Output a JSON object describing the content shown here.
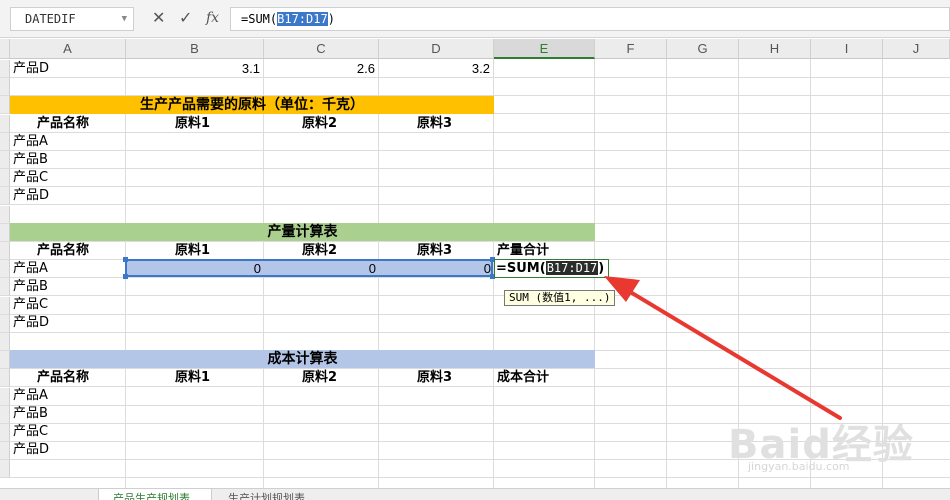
{
  "formula_bar": {
    "name_box": "DATEDIF",
    "cancel_icon": "close-icon",
    "confirm_icon": "check-icon",
    "fx_label": "fx",
    "formula_prefix": "=SUM(",
    "formula_ref": "B17:D17",
    "formula_suffix": ")"
  },
  "columns": [
    "A",
    "B",
    "C",
    "D",
    "E",
    "F",
    "G",
    "H",
    "I",
    "J"
  ],
  "active_column": "E",
  "product_d_row": {
    "label": "产品D",
    "b": "3.1",
    "c": "2.6",
    "d": "3.2"
  },
  "section1": {
    "title": "生产产品需要的原料（单位：千克）",
    "headers": [
      "产品名称",
      "原料1",
      "原料2",
      "原料3"
    ],
    "rows": [
      "产品A",
      "产品B",
      "产品C",
      "产品D"
    ]
  },
  "section2": {
    "title": "产量计算表",
    "headers": [
      "产品名称",
      "原料1",
      "原料2",
      "原料3",
      "产量合计"
    ],
    "rows": [
      "产品A",
      "产品B",
      "产品C",
      "产品D"
    ],
    "row_a_values": [
      "0",
      "0",
      "0"
    ],
    "edit_prefix": "=SUM(",
    "edit_ref": "B17:D17",
    "edit_suffix": ")",
    "tooltip": "SUM (数值1, ...)"
  },
  "section3": {
    "title": "成本计算表",
    "headers": [
      "产品名称",
      "原料1",
      "原料2",
      "原料3",
      "成本合计"
    ],
    "rows": [
      "产品A",
      "产品B",
      "产品C",
      "产品D"
    ]
  },
  "sheet_tabs": [
    "产品生产规划表",
    "生产计划规划表"
  ],
  "watermark": {
    "main": "Baid经验",
    "sub": "jingyan.baidu.com"
  },
  "colors": {
    "orange_band": "#ffc000",
    "green_band": "#a9d08e",
    "blue_band": "#b4c6e7",
    "selection": "#3b78c9",
    "arrow": "#e8382f"
  }
}
